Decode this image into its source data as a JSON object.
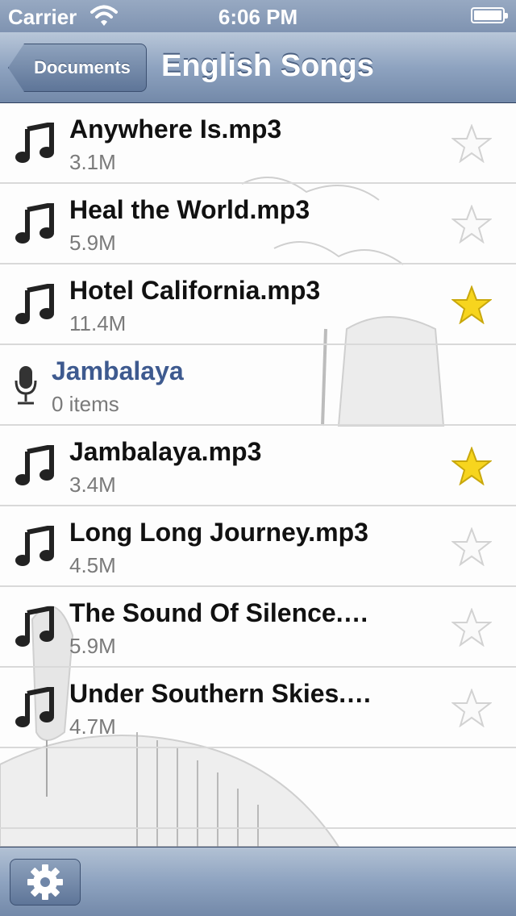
{
  "status_bar": {
    "carrier": "Carrier",
    "time": "6:06 PM"
  },
  "nav": {
    "back_label": "Documents",
    "title": "English Songs"
  },
  "files": [
    {
      "name": "Anywhere Is.mp3",
      "size": "3.1M",
      "type": "audio",
      "starred": false
    },
    {
      "name": "Heal the World.mp3",
      "size": "5.9M",
      "type": "audio",
      "starred": false
    },
    {
      "name": "Hotel California.mp3",
      "size": "11.4M",
      "type": "audio",
      "starred": true
    },
    {
      "name": "Jambalaya",
      "size": "0 items",
      "type": "folder",
      "starred": false
    },
    {
      "name": "Jambalaya.mp3",
      "size": "3.4M",
      "type": "audio",
      "starred": true
    },
    {
      "name": "Long Long Journey.mp3",
      "size": "4.5M",
      "type": "audio",
      "starred": false
    },
    {
      "name": "The Sound Of Silence.…",
      "size": "5.9M",
      "type": "audio",
      "starred": false
    },
    {
      "name": "Under Southern Skies.…",
      "size": "4.7M",
      "type": "audio",
      "starred": false
    }
  ],
  "icons": {
    "audio": "music-note-icon",
    "folder": "microphone-icon",
    "star": "star-icon",
    "settings": "gear-icon"
  },
  "colors": {
    "bar_blue": "#7f93b1",
    "folder_text": "#3e5a8f",
    "star_gold": "#f7d51e"
  }
}
